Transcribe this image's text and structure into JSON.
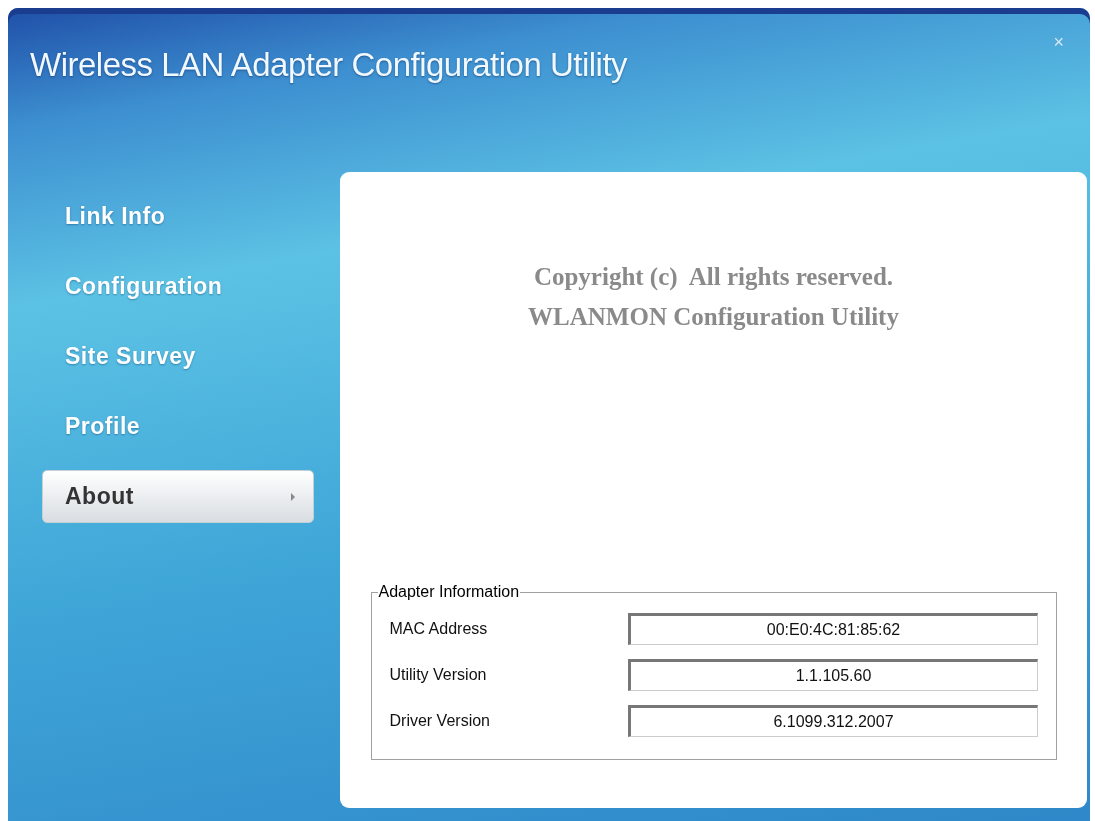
{
  "window": {
    "title": "Wireless LAN Adapter Configuration Utility",
    "close": "×"
  },
  "sidebar": {
    "items": [
      {
        "label": "Link Info",
        "selected": false
      },
      {
        "label": "Configuration",
        "selected": false
      },
      {
        "label": "Site Survey",
        "selected": false
      },
      {
        "label": "Profile",
        "selected": false
      },
      {
        "label": "About",
        "selected": true
      }
    ]
  },
  "about": {
    "lines": [
      "Copyright (c)  All rights reserved.",
      "WLANMON Configuration Utility"
    ],
    "adapter_information": {
      "title": "Adapter Information",
      "rows": [
        {
          "label": "MAC Address",
          "value": "00:E0:4C:81:85:62"
        },
        {
          "label": "Utility Version",
          "value": "1.1.105.60"
        },
        {
          "label": "Driver Version",
          "value": "6.1099.312.2007"
        }
      ]
    }
  }
}
